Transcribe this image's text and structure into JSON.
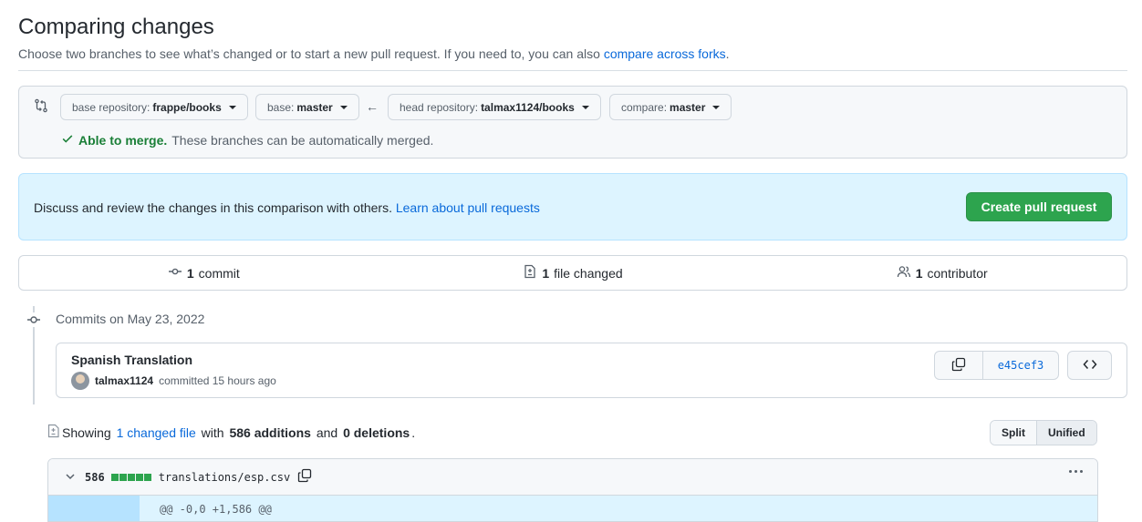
{
  "header": {
    "title": "Comparing changes",
    "subtitle": "Choose two branches to see what’s changed or to start a new pull request. If you need to, you can also ",
    "subtitle_link": "compare across forks",
    "subtitle_end": "."
  },
  "range": {
    "base_repo_prefix": "base repository:",
    "base_repo": "frappe/books",
    "base_prefix": "base:",
    "base": "master",
    "head_repo_prefix": "head repository:",
    "head_repo": "talmax1124/books",
    "compare_prefix": "compare:",
    "compare": "master",
    "merge_ok": "Able to merge.",
    "merge_msg": "These branches can be automatically merged."
  },
  "banner": {
    "text": "Discuss and review the changes in this comparison with others. ",
    "link": "Learn about pull requests",
    "button": "Create pull request"
  },
  "summary": {
    "commits_count": "1",
    "commits_label": "commit",
    "files_count": "1",
    "files_label": "file changed",
    "contributors_count": "1",
    "contributors_label": "contributor"
  },
  "commits": {
    "date_heading": "Commits on May 23, 2022",
    "items": [
      {
        "title": "Spanish Translation",
        "author": "talmax1124",
        "meta": "committed 15 hours ago",
        "sha": "e45cef3"
      }
    ]
  },
  "diff": {
    "showing": "Showing ",
    "changed_link": "1 changed file",
    "with": " with ",
    "additions": "586 additions",
    "and": " and ",
    "deletions": "0 deletions",
    "period": ".",
    "split": "Split",
    "unified": "Unified",
    "file": {
      "count": "586",
      "path": "translations/esp.csv",
      "hunk": "@@ -0,0 +1,586 @@"
    }
  },
  "colors": {
    "accent": "#0969da",
    "success": "#1a7f37",
    "button_green": "#2da44e"
  }
}
